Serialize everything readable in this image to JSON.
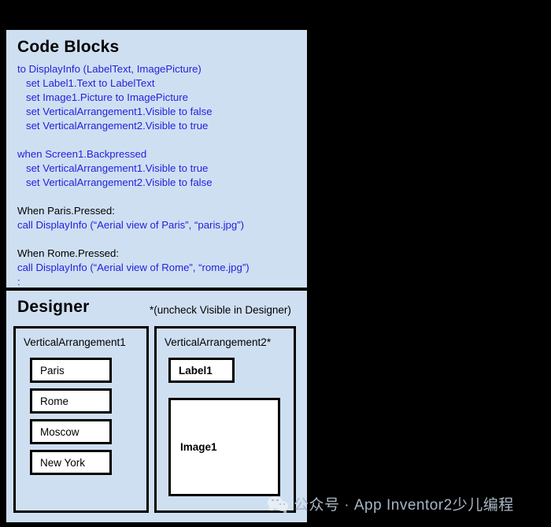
{
  "colors": {
    "page_background": "#000000",
    "panel_background": "#cfdff2",
    "code_text": "#2222dd",
    "plain_text": "#000000",
    "box_fill": "#ffffff",
    "box_border": "#000000",
    "watermark_text": "#a8b6c4"
  },
  "code_blocks": {
    "heading": "Code Blocks",
    "lines": [
      {
        "text": "to DisplayInfo (LabelText, ImagePicture)",
        "color": "blue",
        "indent": 0
      },
      {
        "text": "set Label1.Text to LabelText",
        "color": "blue",
        "indent": 1
      },
      {
        "text": "set Image1.Picture to ImagePicture",
        "color": "blue",
        "indent": 1
      },
      {
        "text": "set VerticalArrangement1.Visible to false",
        "color": "blue",
        "indent": 1
      },
      {
        "text": "set VerticalArrangement2.Visible to true",
        "color": "blue",
        "indent": 1
      },
      {
        "text": "",
        "color": "blank",
        "indent": 0
      },
      {
        "text": "when Screen1.Backpressed",
        "color": "blue",
        "indent": 0
      },
      {
        "text": "set VerticalArrangement1.Visible to true",
        "color": "blue",
        "indent": 1
      },
      {
        "text": "set VerticalArrangement2.Visible to false",
        "color": "blue",
        "indent": 1
      },
      {
        "text": "",
        "color": "blank",
        "indent": 0
      },
      {
        "text": "When Paris.Pressed:",
        "color": "black",
        "indent": 0
      },
      {
        "text": "call DisplayInfo (“Aerial view of Paris”, “paris.jpg”)",
        "color": "blue",
        "indent": 0
      },
      {
        "text": "",
        "color": "blank",
        "indent": 0
      },
      {
        "text": "When Rome.Pressed:",
        "color": "black",
        "indent": 0
      },
      {
        "text": "call DisplayInfo (“Aerial view of Rome”, “rome.jpg”)",
        "color": "blue",
        "indent": 0
      },
      {
        "text": ":",
        "color": "blue",
        "indent": 0
      }
    ]
  },
  "designer": {
    "heading": "Designer",
    "note": "*(uncheck Visible in Designer)",
    "arrangement1": {
      "title": "VerticalArrangement1",
      "buttons": [
        {
          "label": "Paris"
        },
        {
          "label": "Rome"
        },
        {
          "label": "Moscow"
        },
        {
          "label": "New York"
        }
      ]
    },
    "arrangement2": {
      "title": "VerticalArrangement2*",
      "label_component": "Label1",
      "image_component": "Image1"
    }
  },
  "watermark": {
    "icon": "wechat-icon",
    "text": "公众号 · App Inventor2少儿编程"
  }
}
